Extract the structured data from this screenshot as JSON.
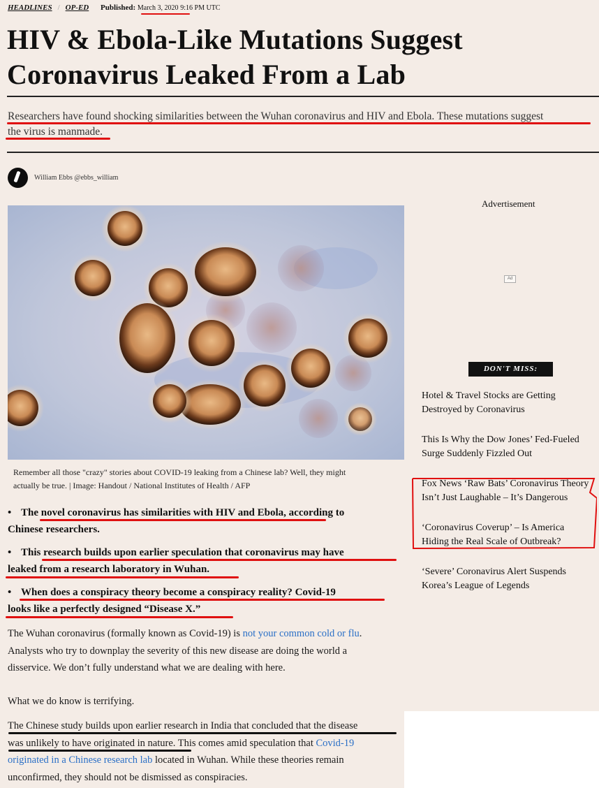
{
  "breadcrumb": {
    "category1": "HEADLINES",
    "category2": "OP-ED",
    "published_label": "Published:",
    "date": "March 3, 2020",
    "time": "9:16 PM UTC"
  },
  "article": {
    "title_line1": "HIV & Ebola-Like Mutations Suggest",
    "title_line2": "Coronavirus Leaked From a Lab",
    "subtitle_line1": "Researchers have found shocking similarities between the Wuhan coronavirus and HIV and Ebola. These mutations suggest",
    "subtitle_line2": "the virus is manmade.",
    "author": "William Ebbs @ebbs_william",
    "caption_line1": "Remember all those \"crazy\" stories about COVID-19 leaking from a Chinese lab? Well, they might",
    "caption_line2": "actually be true. | Image: Handout / National Institutes of Health / AFP",
    "bullets": [
      {
        "line1": "The novel coronavirus has similarities with HIV and Ebola, according to",
        "line2": "Chinese researchers."
      },
      {
        "line1": "This research builds upon earlier speculation that coronavirus may have",
        "line2": "leaked from a research laboratory in Wuhan."
      },
      {
        "line1": "When does a conspiracy theory become a conspiracy reality? Covid-19",
        "line2": "looks like a perfectly designed “Disease X.”"
      }
    ],
    "p1_a": "The Wuhan coronavirus (formally known as Covid-19) is ",
    "p1_link": "not your common cold or flu",
    "p1_b": ".",
    "p1_line2": "Analysts who try to downplay the severity of this new disease are doing the world a",
    "p1_line3": "disservice. We don’t fully understand what we are dealing with here.",
    "p2": "What we do know is terrifying.",
    "p3_line1": "The Chinese study builds upon earlier research in India that concluded that the disease",
    "p3_line2a": "was unlikely to have originated in nature",
    "p3_line2b": ". This comes amid speculation that ",
    "p3_link1": "Covid-19",
    "p3_link2": "originated in a Chinese research lab",
    "p3_line3b": " located in Wuhan. While these theories remain",
    "p3_line4": "unconfirmed, they should not be dismissed as conspiracies."
  },
  "sidebar": {
    "ad_label": "Advertisement",
    "ad_badge": "Ad",
    "dont_miss": "DON'T MISS:",
    "items": [
      {
        "line1": "Hotel & Travel Stocks are Getting",
        "line2": "Destroyed by Coronavirus"
      },
      {
        "line1": "This Is Why the Dow Jones’ Fed-Fueled",
        "line2": "Surge Suddenly Fizzled Out"
      },
      {
        "line1": "Fox News ‘Raw Bats’ Coronavirus Theory",
        "line2": "Isn’t Just Laughable – It’s Dangerous"
      },
      {
        "line1": "‘Coronavirus Coverup’ – Is America",
        "line2": "Hiding the Real Scale of Outbreak?"
      },
      {
        "line1": "‘Severe’ Coronavirus Alert Suspends",
        "line2": "Korea’s League of Legends"
      }
    ]
  },
  "colors": {
    "annotation_red": "#e01010",
    "link_blue": "#2a6fc6",
    "page_bg": "#f4ece6"
  },
  "icons": {
    "author_avatar": "author-avatar-icon"
  }
}
